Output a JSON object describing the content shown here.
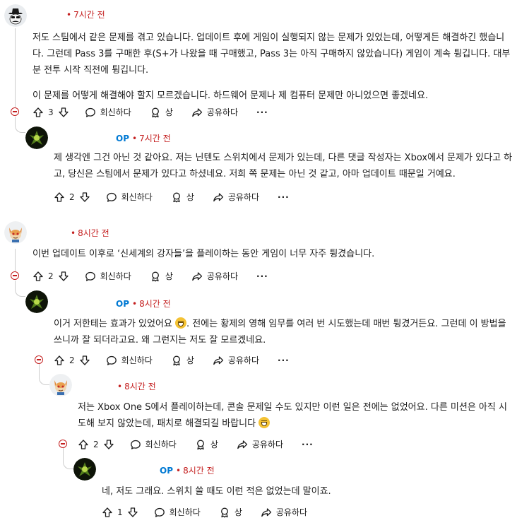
{
  "comments": [
    {
      "time": "7시간 전",
      "op": "",
      "paragraphs": [
        "저도 스팀에서 같은 문제를 겪고 있습니다. 업데이트 후에 게임이 실행되지 않는 문제가 있었는데, 어떻게든 해결하긴 했습니다. 그런데 Pass 3를 구매한 후(S+가 나왔을 때 구매했고, Pass 3는 아직 구매하지 않았습니다) 게임이 계속 튕깁니다. 대부분 전투 시작 직전에 튕깁니다.",
        "이 문제를 어떻게 해결해야 할지 모르겠습니다. 하드웨어 문제나 제 컴퓨터 문제만 아니었으면 좋겠네요."
      ],
      "votes": "3"
    },
    {
      "time": "7시간 전",
      "op": "OP",
      "paragraphs": [
        "제 생각엔 그건 아닌 것 같아요. 저는 닌텐도 스위치에서 문제가 있는데, 다른 댓글 작성자는 Xbox에서 문제가 있다고 하고, 당신은 스팀에서 문제가 있다고 하셨네요. 저희 쪽 문제는 아닌 것 같고, 아마 업데이트 때문일 거예요."
      ],
      "votes": "2"
    },
    {
      "time": "8시간 전",
      "op": "",
      "paragraphs": [
        "이번 업데이트 이후로 ‘신세계의 강자들’을 플레이하는 동안 게임이 너무 자주 튕겼습니다."
      ],
      "votes": "2"
    },
    {
      "time": "8시간 전",
      "op": "OP",
      "text_before_emoji": "이거 저한테는 효과가 있었어요 ",
      "text_after_emoji": ". 전에는 황제의 영해 임무를 여러 번 시도했는데 매번 튕겼거든요. 그런데 이 방법을 쓰니까 잘 되더라고요. 왜 그런지는 저도 잘 모르겠네요.",
      "votes": "2"
    },
    {
      "time": "8시간 전",
      "op": "",
      "text_before_emoji": "저는 Xbox One S에서 플레이하는데, 콘솔 문제일 수도 있지만 이런 일은 전에는 없었어요. 다른 미션은 아직 시도해 보지 않았는데, 패치로 해결되길 바랍니다 ",
      "votes": "2"
    },
    {
      "time": "8시간 전",
      "op": "OP",
      "paragraphs": [
        "네, 저도 그래요. 스위치 쓸 때도 이런 적은 없었는데 말이죠."
      ],
      "votes": "1"
    }
  ],
  "labels": {
    "reply": "회신하다",
    "award": "상",
    "share": "공유하다",
    "more": "···"
  },
  "colors": {
    "time": "#c41f1f",
    "op": "#0079d3",
    "collapse": "#c41f1f"
  }
}
